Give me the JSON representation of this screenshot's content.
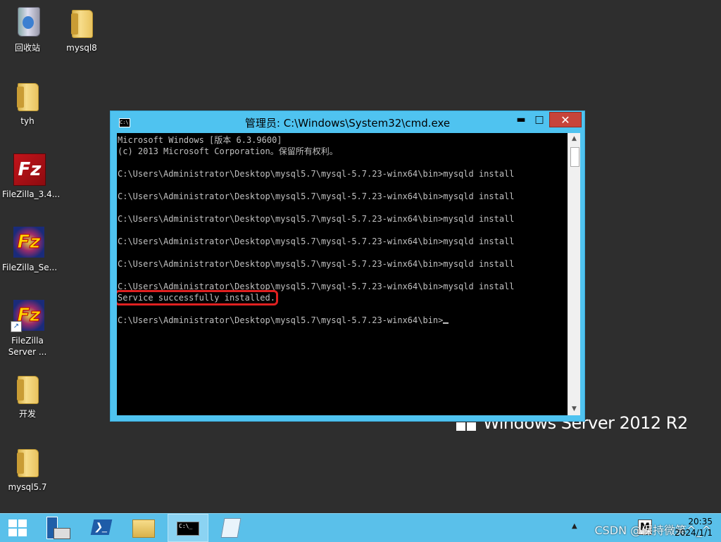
{
  "desktop": {
    "icons": [
      {
        "label": "回收站",
        "type": "recycle-bin"
      },
      {
        "label": "mysql8",
        "type": "folder"
      },
      {
        "label": "tyh",
        "type": "folder"
      },
      {
        "label": "FileZilla_3.4...",
        "type": "filezilla-client"
      },
      {
        "label": "FileZilla_Se...",
        "type": "filezilla-server"
      },
      {
        "label": "FileZilla Server ...",
        "type": "filezilla-server-shortcut"
      },
      {
        "label": "开发",
        "type": "folder"
      },
      {
        "label": "mysql5.7",
        "type": "folder"
      }
    ],
    "brand": "Windows Server 2012 R2"
  },
  "cmd_window": {
    "title": "管理员: C:\\Windows\\System32\\cmd.exe",
    "icon_text": "C:\\",
    "buttons": {
      "minimize": "▬",
      "maximize": "□",
      "close": "✕"
    },
    "lines": [
      "Microsoft Windows [版本 6.3.9600]",
      "(c) 2013 Microsoft Corporation。保留所有权利。",
      "",
      "C:\\Users\\Administrator\\Desktop\\mysql5.7\\mysql-5.7.23-winx64\\bin>mysqld install",
      "",
      "C:\\Users\\Administrator\\Desktop\\mysql5.7\\mysql-5.7.23-winx64\\bin>mysqld install",
      "",
      "C:\\Users\\Administrator\\Desktop\\mysql5.7\\mysql-5.7.23-winx64\\bin>mysqld install",
      "",
      "C:\\Users\\Administrator\\Desktop\\mysql5.7\\mysql-5.7.23-winx64\\bin>mysqld install",
      "",
      "C:\\Users\\Administrator\\Desktop\\mysql5.7\\mysql-5.7.23-winx64\\bin>mysqld install",
      "",
      "C:\\Users\\Administrator\\Desktop\\mysql5.7\\mysql-5.7.23-winx64\\bin>mysqld install",
      "Service successfully installed.",
      "",
      "C:\\Users\\Administrator\\Desktop\\mysql5.7\\mysql-5.7.23-winx64\\bin>"
    ],
    "highlight_line_index": 14
  },
  "taskbar": {
    "items": [
      "start",
      "server-manager",
      "powershell",
      "file-explorer",
      "command-prompt",
      "notepad"
    ],
    "active_item": "command-prompt",
    "cmd_icon_text": "C:\\_",
    "tray_label": "▲",
    "ime_label": "M",
    "watermark": "CSDN @保持微笑^_^",
    "time": "20:35",
    "date": "2024/1/1"
  },
  "colors": {
    "desktop_bg": "#2e2e2e",
    "window_frame": "#4fc3f0",
    "close_button": "#c7443a",
    "taskbar": "#5ac0ea",
    "highlight": "#e02020"
  }
}
